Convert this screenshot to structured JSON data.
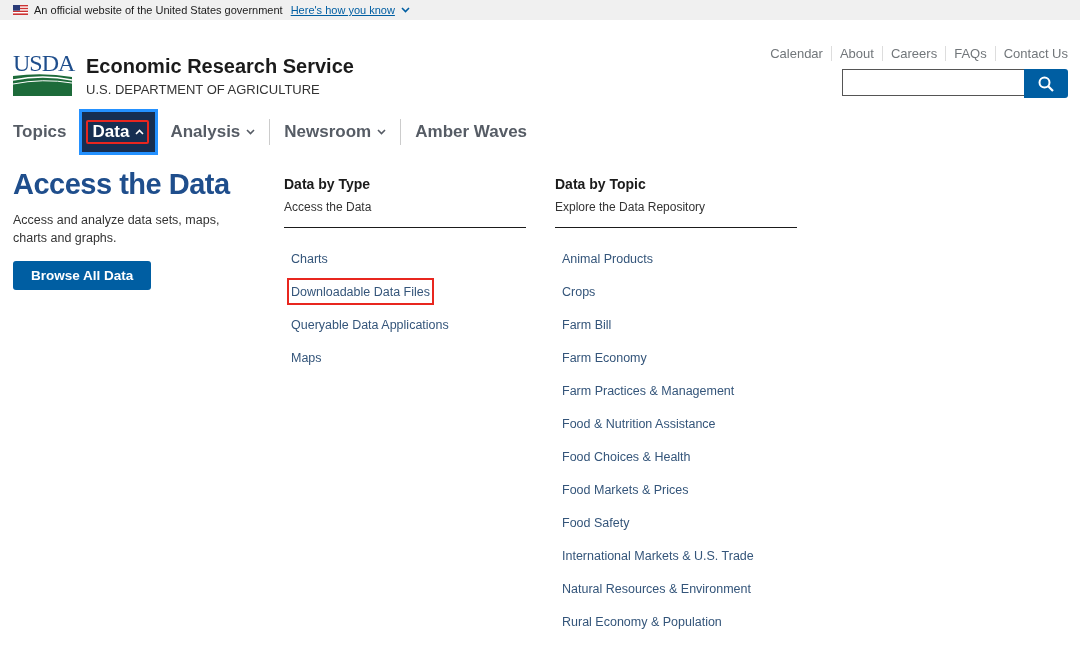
{
  "gov_banner": {
    "text": "An official website of the United States government",
    "link": "Here's how you know"
  },
  "header": {
    "logo": "USDA",
    "title": "Economic Research Service",
    "subtitle": "U.S. DEPARTMENT OF AGRICULTURE"
  },
  "utility_links": [
    "Calendar",
    "About",
    "Careers",
    "FAQs",
    "Contact Us"
  ],
  "nav": [
    {
      "label": "Topics",
      "dropdown": false,
      "expanded": false,
      "highlighted": false
    },
    {
      "label": "Data",
      "dropdown": true,
      "expanded": true,
      "highlighted": true
    },
    {
      "label": "Analysis",
      "dropdown": true,
      "expanded": false,
      "highlighted": false
    },
    {
      "label": "Newsroom",
      "dropdown": true,
      "expanded": false,
      "highlighted": false
    },
    {
      "label": "Amber Waves",
      "dropdown": false,
      "expanded": false,
      "highlighted": false
    }
  ],
  "intro": {
    "title": "Access the Data",
    "text": "Access and analyze data sets, maps, charts and graphs.",
    "button": "Browse All Data"
  },
  "columns": [
    {
      "title": "Data by Type",
      "subtitle": "Access the Data",
      "links": [
        {
          "label": "Charts",
          "highlighted": false
        },
        {
          "label": "Downloadable Data Files",
          "highlighted": true
        },
        {
          "label": "Queryable Data Applications",
          "highlighted": false
        },
        {
          "label": "Maps",
          "highlighted": false
        }
      ]
    },
    {
      "title": "Data by Topic",
      "subtitle": "Explore the Data Repository",
      "links": [
        {
          "label": "Animal Products",
          "highlighted": false
        },
        {
          "label": "Crops",
          "highlighted": false
        },
        {
          "label": "Farm Bill",
          "highlighted": false
        },
        {
          "label": "Farm Economy",
          "highlighted": false
        },
        {
          "label": "Farm Practices & Management",
          "highlighted": false
        },
        {
          "label": "Food & Nutrition Assistance",
          "highlighted": false
        },
        {
          "label": "Food Choices & Health",
          "highlighted": false
        },
        {
          "label": "Food Markets & Prices",
          "highlighted": false
        },
        {
          "label": "Food Safety",
          "highlighted": false
        },
        {
          "label": "International Markets & U.S. Trade",
          "highlighted": false
        },
        {
          "label": "Natural Resources & Environment",
          "highlighted": false
        },
        {
          "label": "Rural Economy & Population",
          "highlighted": false
        }
      ]
    }
  ]
}
